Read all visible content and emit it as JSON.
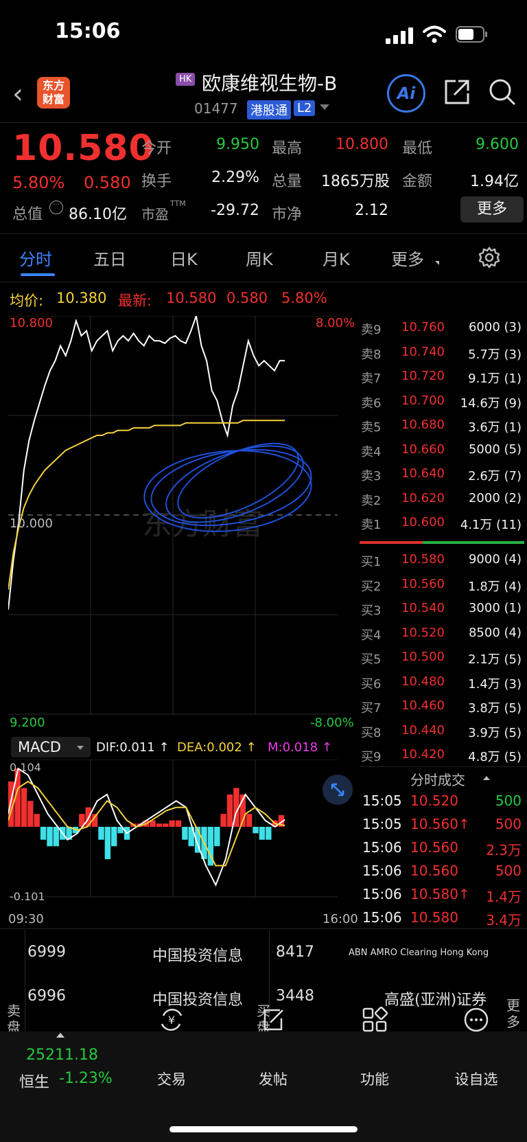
{
  "status": {
    "time": "15:06"
  },
  "header": {
    "market_badge": "HK",
    "stock_name": "欧康维视生物-B",
    "stock_code": "01477",
    "tag_connect": "港股通",
    "tag_level": "L2",
    "logo_text_1": "东方",
    "logo_text_2": "财富",
    "ai_label": "Ai"
  },
  "quote": {
    "price": "10.580",
    "change_pct": "5.80%",
    "change_val": "0.580",
    "market_value_label": "总值",
    "market_value": "86.10亿",
    "open_label": "今开",
    "open": "9.950",
    "high_label": "最高",
    "high": "10.800",
    "low_label": "最低",
    "low": "9.600",
    "turnover_label": "换手",
    "turnover": "2.29%",
    "volume_label": "总量",
    "volume": "1865万股",
    "amount_label": "金额",
    "amount": "1.94亿",
    "pe_label": "市盈",
    "pe_sup": "TTM",
    "pe": "-29.72",
    "pb_label": "市净",
    "pb": "2.12",
    "more_button": "更多"
  },
  "tabs": [
    {
      "label": "分时"
    },
    {
      "label": "五日"
    },
    {
      "label": "日K"
    },
    {
      "label": "周K"
    },
    {
      "label": "月K"
    },
    {
      "label": "更多"
    }
  ],
  "summary": {
    "avg_label": "均价:",
    "avg": "10.380",
    "latest_label": "最新:",
    "latest": "10.580",
    "latest_chg": "0.580",
    "latest_pct": "5.80%"
  },
  "chart_data": {
    "type": "line",
    "title": "",
    "y_top": "10.800",
    "y_mid": "10.000",
    "y_bottom": "9.200",
    "pct_top": "8.00%",
    "pct_bottom": "-8.00%",
    "x_start": "09:30",
    "x_end": "16:00",
    "ylim": [
      9.2,
      10.8
    ],
    "series": [
      {
        "name": "",
        "color": "#ffffff",
        "values": [
          9.62,
          9.82,
          9.97,
          10.18,
          10.3,
          10.38,
          10.45,
          10.52,
          10.58,
          10.62,
          10.68,
          10.64,
          10.7,
          10.78,
          10.72,
          10.74,
          10.66,
          10.7,
          10.72,
          10.74,
          10.66,
          10.7,
          10.72,
          10.7,
          10.73,
          10.7,
          10.68,
          10.72,
          10.7,
          10.7,
          10.69,
          10.71,
          10.72,
          10.7,
          10.69,
          10.74,
          10.8,
          10.68,
          10.62,
          10.5,
          10.46,
          10.38,
          10.32,
          10.44,
          10.5,
          10.6,
          10.7,
          10.64,
          10.6,
          10.62,
          10.6,
          10.58,
          10.62,
          10.62
        ]
      },
      {
        "name": "",
        "color": "#f5d33c",
        "values": [
          9.7,
          9.85,
          9.95,
          10.03,
          10.08,
          10.12,
          10.15,
          10.18,
          10.2,
          10.22,
          10.24,
          10.26,
          10.27,
          10.28,
          10.29,
          10.3,
          10.31,
          10.32,
          10.32,
          10.33,
          10.33,
          10.34,
          10.34,
          10.34,
          10.35,
          10.35,
          10.35,
          10.35,
          10.36,
          10.36,
          10.36,
          10.36,
          10.36,
          10.36,
          10.37,
          10.37,
          10.37,
          10.37,
          10.37,
          10.37,
          10.37,
          10.37,
          10.37,
          10.37,
          10.37,
          10.38,
          10.38,
          10.38,
          10.38,
          10.38,
          10.38,
          10.38,
          10.38,
          10.38
        ]
      }
    ]
  },
  "macd": {
    "label": "MACD",
    "dif": "DIF:0.011 ↑",
    "dea": "DEA:0.002 ↑",
    "m": "M:0.018 ↑",
    "y_top": "0.104",
    "y_bottom": "-0.101",
    "hist": [
      0.07,
      0.09,
      0.06,
      0.04,
      0.02,
      -0.02,
      -0.03,
      -0.03,
      -0.02,
      -0.02,
      -0.01,
      0.02,
      0.03,
      0.02,
      -0.02,
      -0.05,
      -0.03,
      -0.01,
      -0.02,
      0.005,
      0.005,
      0.01,
      0.01,
      0.005,
      0.005,
      0.01,
      0.01,
      -0.02,
      -0.03,
      -0.04,
      -0.05,
      -0.06,
      -0.03,
      0.02,
      0.05,
      0.06,
      0.05,
      0.02,
      -0.01,
      -0.02,
      -0.02,
      0.01,
      0.018
    ],
    "dif_line": [
      0.02,
      0.09,
      0.08,
      0.05,
      0.02,
      0.0,
      -0.02,
      -0.01,
      0.01,
      0.04,
      0.05,
      0.01,
      -0.01,
      0.0,
      0.01,
      0.02,
      0.03,
      0.04,
      0.03,
      -0.02,
      -0.06,
      -0.09,
      -0.05,
      0.02,
      0.05,
      0.03,
      0.01,
      0.0,
      0.011
    ],
    "dea_line": [
      0.01,
      0.06,
      0.07,
      0.06,
      0.04,
      0.02,
      0.0,
      -0.005,
      0.0,
      0.02,
      0.04,
      0.03,
      0.01,
      0.0,
      0.005,
      0.015,
      0.025,
      0.03,
      0.03,
      0.0,
      -0.03,
      -0.06,
      -0.06,
      -0.02,
      0.02,
      0.03,
      0.02,
      0.005,
      0.002
    ]
  },
  "orderbook": {
    "asks": [
      {
        "label": "卖9",
        "price": "10.760",
        "vol": "6000 (3)"
      },
      {
        "label": "卖8",
        "price": "10.740",
        "vol": "5.7万 (3)"
      },
      {
        "label": "卖7",
        "price": "10.720",
        "vol": "9.1万 (1)"
      },
      {
        "label": "卖6",
        "price": "10.700",
        "vol": "14.6万 (9)"
      },
      {
        "label": "卖5",
        "price": "10.680",
        "vol": "3.6万 (1)"
      },
      {
        "label": "卖4",
        "price": "10.660",
        "vol": "5000 (5)"
      },
      {
        "label": "卖3",
        "price": "10.640",
        "vol": "2.6万 (7)"
      },
      {
        "label": "卖2",
        "price": "10.620",
        "vol": "2000 (2)"
      },
      {
        "label": "卖1",
        "price": "10.600",
        "vol": "4.1万 (11)"
      }
    ],
    "bids": [
      {
        "label": "买1",
        "price": "10.580",
        "vol": "9000 (4)"
      },
      {
        "label": "买2",
        "price": "10.560",
        "vol": "1.8万 (4)"
      },
      {
        "label": "买3",
        "price": "10.540",
        "vol": "3000 (1)"
      },
      {
        "label": "买4",
        "price": "10.520",
        "vol": "8500 (4)"
      },
      {
        "label": "买5",
        "price": "10.500",
        "vol": "2.1万 (5)"
      },
      {
        "label": "买6",
        "price": "10.480",
        "vol": "1.4万 (3)"
      },
      {
        "label": "买7",
        "price": "10.460",
        "vol": "3.8万 (5)"
      },
      {
        "label": "买8",
        "price": "10.440",
        "vol": "3.9万 (5)"
      },
      {
        "label": "买9",
        "price": "10.420",
        "vol": "4.8万 (5)"
      }
    ]
  },
  "trades": {
    "title": "分时成交",
    "rows": [
      {
        "time": "15:05",
        "price": "10.520",
        "vol": "500",
        "side": "buy"
      },
      {
        "time": "15:05",
        "price": "10.560↑",
        "vol": "500",
        "side": "sell"
      },
      {
        "time": "15:06",
        "price": "10.560",
        "vol": "2.3万",
        "side": "sell"
      },
      {
        "time": "15:06",
        "price": "10.560",
        "vol": "500",
        "side": "sell"
      },
      {
        "time": "15:06",
        "price": "10.580↑",
        "vol": "1.4万",
        "side": "sell"
      },
      {
        "time": "15:06",
        "price": "10.580",
        "vol": "3.4万",
        "side": "sell"
      }
    ]
  },
  "brokers": {
    "sell_side_label": "卖盘",
    "buy_side_label": "买盘",
    "more_label": "更多",
    "sell": [
      {
        "id": "6999",
        "name": "中国投资信息"
      },
      {
        "id": "6996",
        "name": "中国投资信息"
      }
    ],
    "buy": [
      {
        "id": "8417",
        "name": "ABN AMRO Clearing Hong Kong"
      },
      {
        "id": "3448",
        "name": "高盛(亚洲)证券"
      }
    ]
  },
  "bottom_nav": {
    "index_value": "25211.18",
    "index_name": "恒生",
    "index_change": "-1.23%",
    "items": [
      {
        "label": "交易"
      },
      {
        "label": "发帖"
      },
      {
        "label": "功能"
      },
      {
        "label": "设自选"
      }
    ]
  },
  "watermark": "东方财富"
}
